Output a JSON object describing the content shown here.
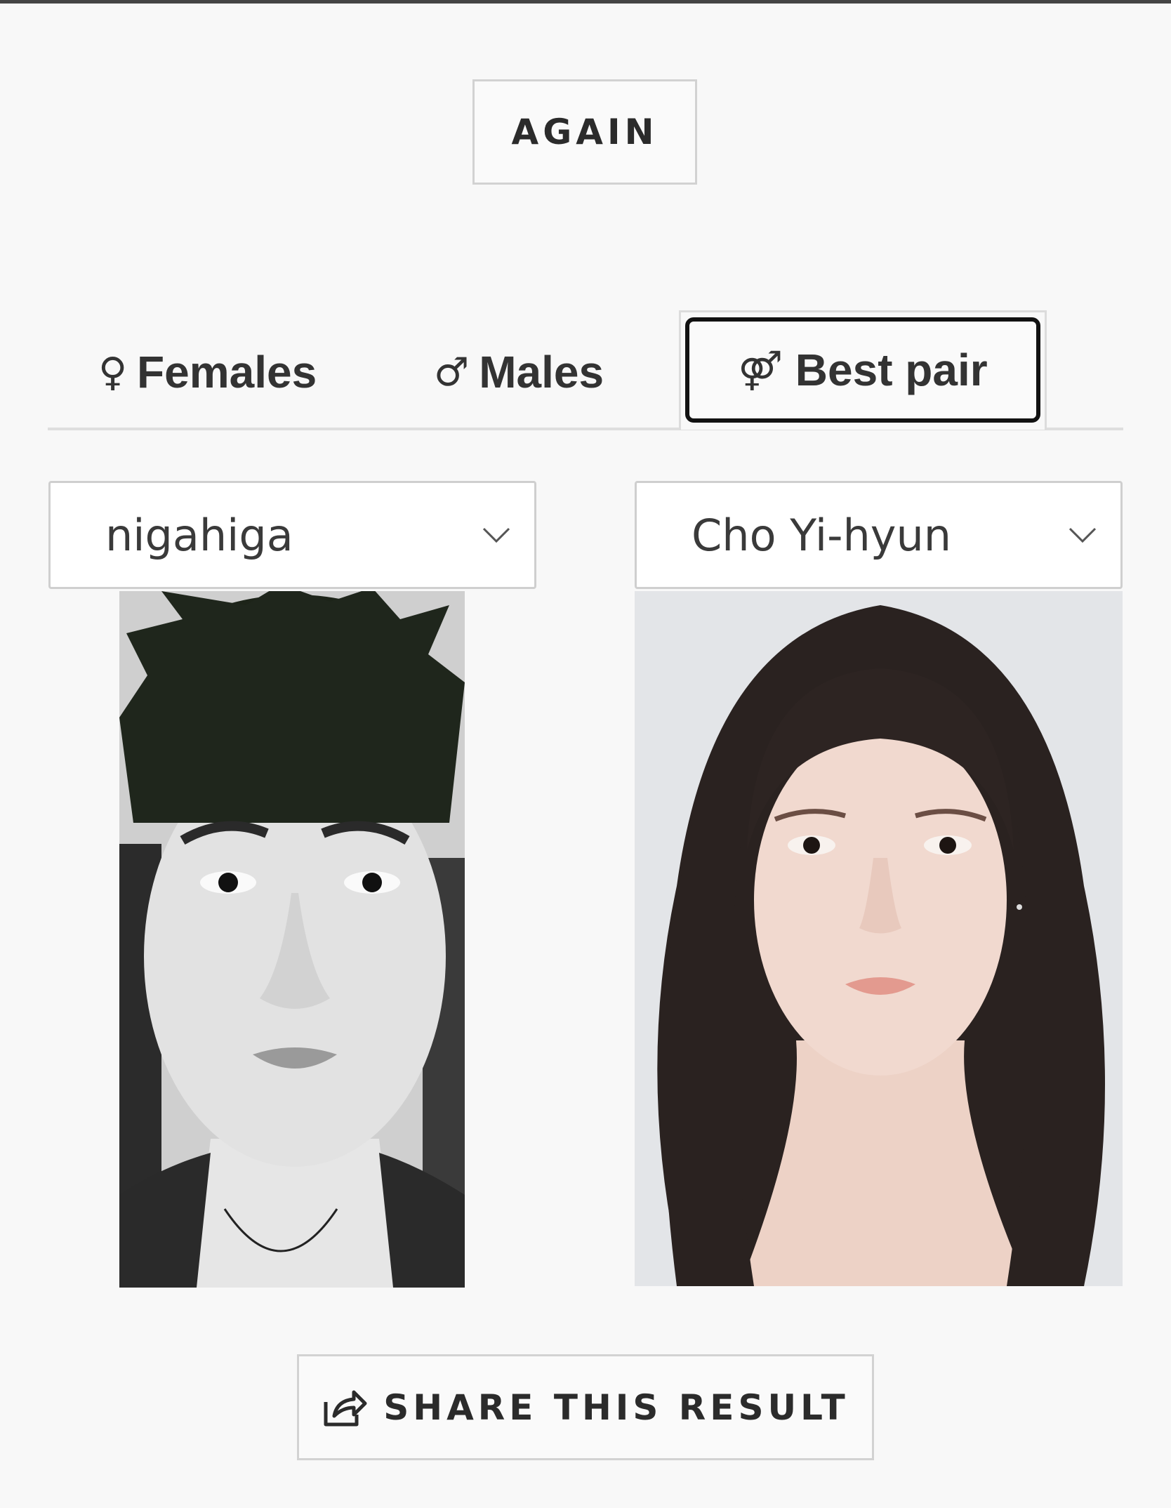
{
  "again_button": {
    "label": "AGAIN"
  },
  "tabs": [
    {
      "symbol": "♀",
      "label": "Females",
      "active": false
    },
    {
      "symbol": "♂",
      "label": "Males",
      "active": false
    },
    {
      "symbol": "⚤",
      "label": "Best pair",
      "active": true
    }
  ],
  "selects": {
    "left": {
      "value": "nigahiga"
    },
    "right": {
      "value": "Cho Yi-hyun"
    }
  },
  "share_button": {
    "label": "SHARE THIS RESULT"
  },
  "colors": {
    "background": "#f8f8f8",
    "text": "#333333",
    "active_tab_border": "#111111",
    "border": "#d2d2d2"
  },
  "icons": {
    "select_chevron": "chevron-down-icon",
    "share": "share-icon"
  }
}
